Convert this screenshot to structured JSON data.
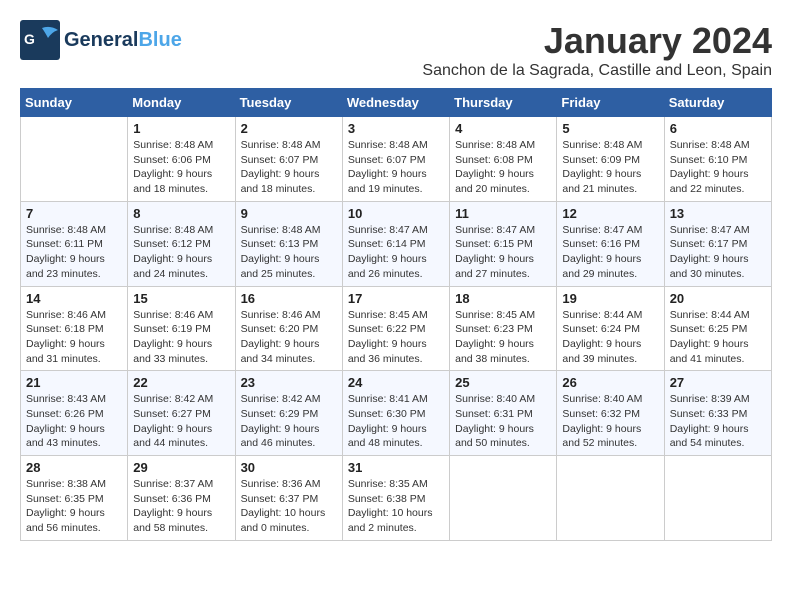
{
  "header": {
    "logo_general": "General",
    "logo_blue": "Blue",
    "month_title": "January 2024",
    "location": "Sanchon de la Sagrada, Castille and Leon, Spain"
  },
  "days_of_week": [
    "Sunday",
    "Monday",
    "Tuesday",
    "Wednesday",
    "Thursday",
    "Friday",
    "Saturday"
  ],
  "weeks": [
    [
      {
        "day": "",
        "content": ""
      },
      {
        "day": "1",
        "content": "Sunrise: 8:48 AM\nSunset: 6:06 PM\nDaylight: 9 hours\nand 18 minutes."
      },
      {
        "day": "2",
        "content": "Sunrise: 8:48 AM\nSunset: 6:07 PM\nDaylight: 9 hours\nand 18 minutes."
      },
      {
        "day": "3",
        "content": "Sunrise: 8:48 AM\nSunset: 6:07 PM\nDaylight: 9 hours\nand 19 minutes."
      },
      {
        "day": "4",
        "content": "Sunrise: 8:48 AM\nSunset: 6:08 PM\nDaylight: 9 hours\nand 20 minutes."
      },
      {
        "day": "5",
        "content": "Sunrise: 8:48 AM\nSunset: 6:09 PM\nDaylight: 9 hours\nand 21 minutes."
      },
      {
        "day": "6",
        "content": "Sunrise: 8:48 AM\nSunset: 6:10 PM\nDaylight: 9 hours\nand 22 minutes."
      }
    ],
    [
      {
        "day": "7",
        "content": ""
      },
      {
        "day": "8",
        "content": "Sunrise: 8:48 AM\nSunset: 6:12 PM\nDaylight: 9 hours\nand 24 minutes."
      },
      {
        "day": "9",
        "content": "Sunrise: 8:48 AM\nSunset: 6:13 PM\nDaylight: 9 hours\nand 25 minutes."
      },
      {
        "day": "10",
        "content": "Sunrise: 8:47 AM\nSunset: 6:14 PM\nDaylight: 9 hours\nand 26 minutes."
      },
      {
        "day": "11",
        "content": "Sunrise: 8:47 AM\nSunset: 6:15 PM\nDaylight: 9 hours\nand 27 minutes."
      },
      {
        "day": "12",
        "content": "Sunrise: 8:47 AM\nSunset: 6:16 PM\nDaylight: 9 hours\nand 29 minutes."
      },
      {
        "day": "13",
        "content": "Sunrise: 8:47 AM\nSunset: 6:17 PM\nDaylight: 9 hours\nand 30 minutes."
      }
    ],
    [
      {
        "day": "14",
        "content": ""
      },
      {
        "day": "15",
        "content": "Sunrise: 8:46 AM\nSunset: 6:19 PM\nDaylight: 9 hours\nand 33 minutes."
      },
      {
        "day": "16",
        "content": "Sunrise: 8:46 AM\nSunset: 6:20 PM\nDaylight: 9 hours\nand 34 minutes."
      },
      {
        "day": "17",
        "content": "Sunrise: 8:45 AM\nSunset: 6:22 PM\nDaylight: 9 hours\nand 36 minutes."
      },
      {
        "day": "18",
        "content": "Sunrise: 8:45 AM\nSunset: 6:23 PM\nDaylight: 9 hours\nand 38 minutes."
      },
      {
        "day": "19",
        "content": "Sunrise: 8:44 AM\nSunset: 6:24 PM\nDaylight: 9 hours\nand 39 minutes."
      },
      {
        "day": "20",
        "content": "Sunrise: 8:44 AM\nSunset: 6:25 PM\nDaylight: 9 hours\nand 41 minutes."
      }
    ],
    [
      {
        "day": "21",
        "content": ""
      },
      {
        "day": "22",
        "content": "Sunrise: 8:42 AM\nSunset: 6:27 PM\nDaylight: 9 hours\nand 44 minutes."
      },
      {
        "day": "23",
        "content": "Sunrise: 8:42 AM\nSunset: 6:29 PM\nDaylight: 9 hours\nand 46 minutes."
      },
      {
        "day": "24",
        "content": "Sunrise: 8:41 AM\nSunset: 6:30 PM\nDaylight: 9 hours\nand 48 minutes."
      },
      {
        "day": "25",
        "content": "Sunrise: 8:40 AM\nSunset: 6:31 PM\nDaylight: 9 hours\nand 50 minutes."
      },
      {
        "day": "26",
        "content": "Sunrise: 8:40 AM\nSunset: 6:32 PM\nDaylight: 9 hours\nand 52 minutes."
      },
      {
        "day": "27",
        "content": "Sunrise: 8:39 AM\nSunset: 6:33 PM\nDaylight: 9 hours\nand 54 minutes."
      }
    ],
    [
      {
        "day": "28",
        "content": ""
      },
      {
        "day": "29",
        "content": "Sunrise: 8:37 AM\nSunset: 6:36 PM\nDaylight: 9 hours\nand 58 minutes."
      },
      {
        "day": "30",
        "content": "Sunrise: 8:36 AM\nSunset: 6:37 PM\nDaylight: 10 hours\nand 0 minutes."
      },
      {
        "day": "31",
        "content": "Sunrise: 8:35 AM\nSunset: 6:38 PM\nDaylight: 10 hours\nand 2 minutes."
      },
      {
        "day": "",
        "content": ""
      },
      {
        "day": "",
        "content": ""
      },
      {
        "day": "",
        "content": ""
      }
    ]
  ],
  "week0_sunday": "Sunrise: 8:48 AM\nSunset: 6:11 PM\nDaylight: 9 hours\nand 23 minutes.",
  "week1_sunday_content": "Sunrise: 8:48 AM\nSunset: 6:11 PM\nDaylight: 9 hours\nand 23 minutes.",
  "week2_sunday_content": "Sunrise: 8:46 AM\nSunset: 6:18 PM\nDaylight: 9 hours\nand 31 minutes.",
  "week3_sunday_content": "Sunrise: 8:43 AM\nSunset: 6:26 PM\nDaylight: 9 hours\nand 43 minutes.",
  "week4_sunday_content": "Sunrise: 8:38 AM\nSunset: 6:35 PM\nDaylight: 9 hours\nand 56 minutes."
}
